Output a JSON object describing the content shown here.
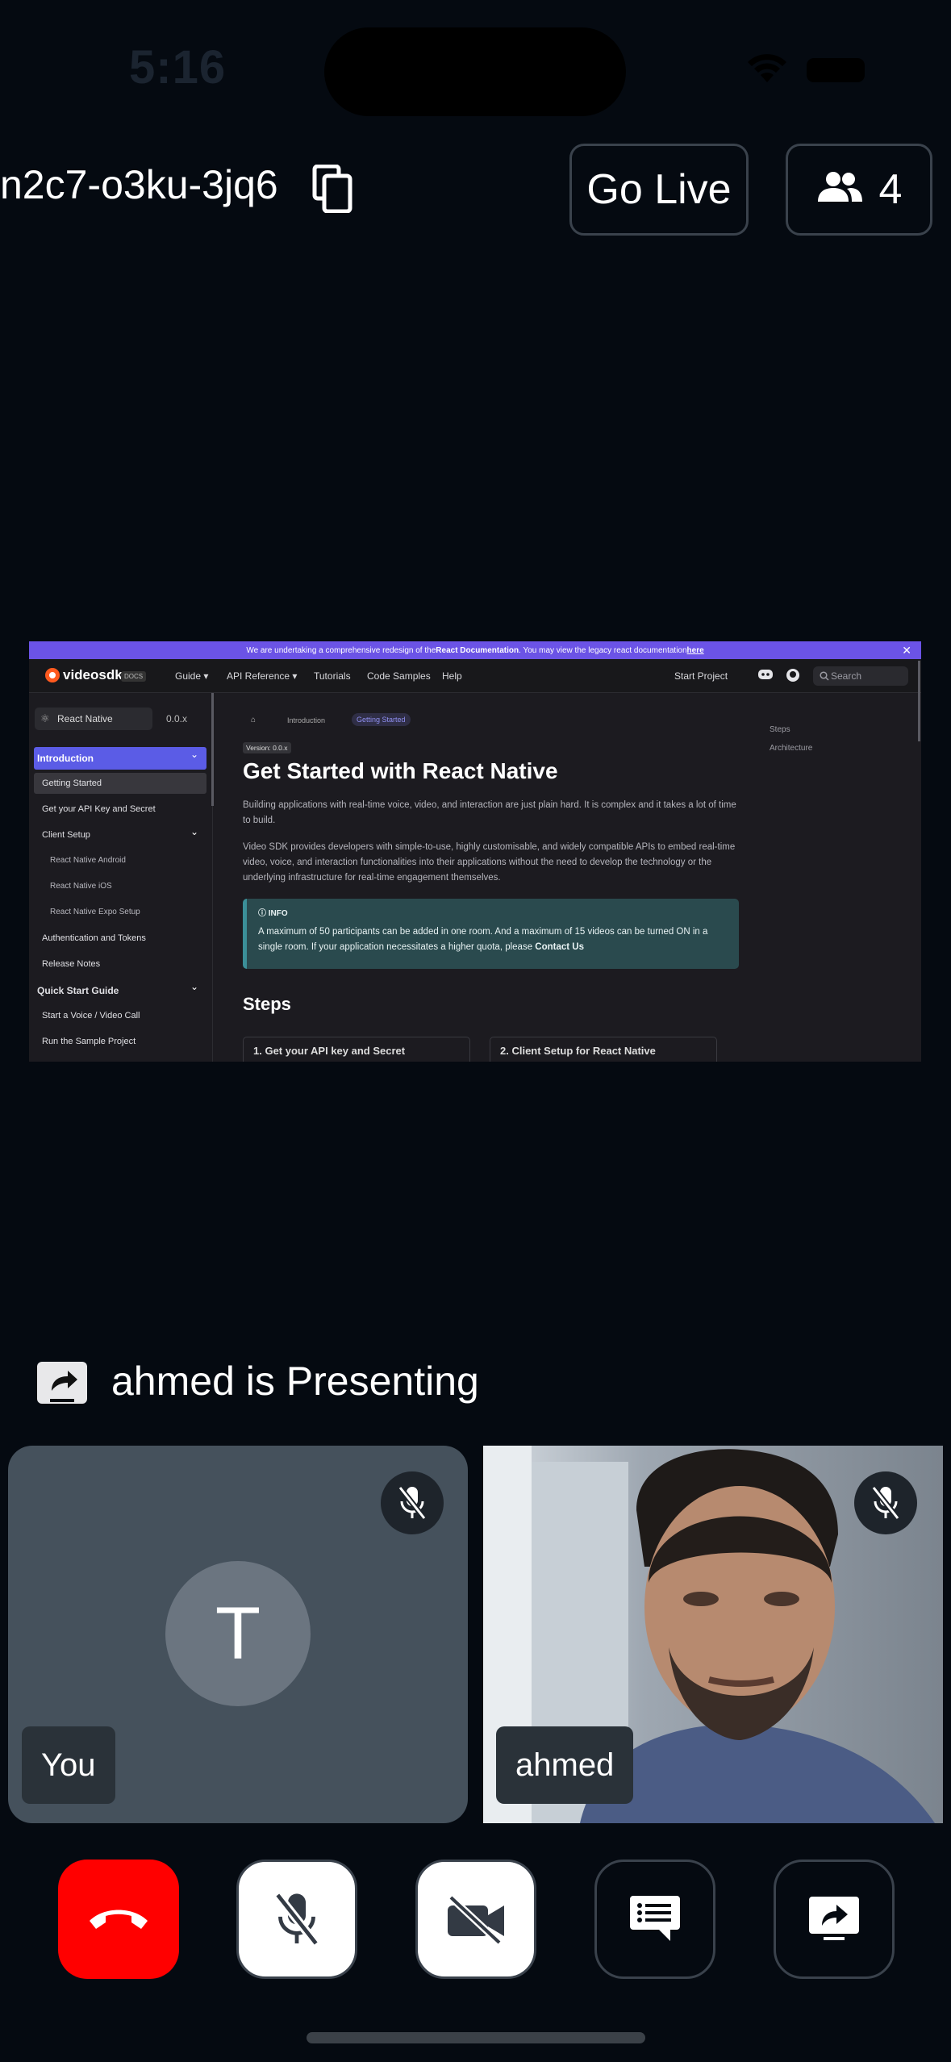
{
  "status_bar": {
    "time": "5:16"
  },
  "header": {
    "meeting_id": "n2c7-o3ku-3jq6",
    "go_live_label": "Go Live",
    "participant_count": "4"
  },
  "shared_screen": {
    "banner_prefix": "We are undertaking a comprehensive redesign of the ",
    "banner_bold": "React Documentation",
    "banner_mid": ". You may view the legacy react documentation ",
    "banner_link": "here",
    "logo": "videosdk",
    "logo_badge": "DOCS",
    "nav": [
      "Guide ▾",
      "API Reference ▾",
      "Tutorials",
      "Code Samples",
      "Help"
    ],
    "nav_right": "Start Project",
    "search_placeholder": "Search",
    "platform_select": "React Native",
    "version_select": "0.0.x",
    "sidebar": [
      {
        "label": "Introduction",
        "kind": "active",
        "chevron": "⌄"
      },
      {
        "label": "Getting Started",
        "kind": "current"
      },
      {
        "label": "Get your API Key and Secret",
        "kind": "normal"
      },
      {
        "label": "Client Setup",
        "kind": "normal",
        "chevron": "⌄"
      },
      {
        "label": "React Native Android",
        "kind": "sub"
      },
      {
        "label": "React Native iOS",
        "kind": "sub"
      },
      {
        "label": "React Native Expo Setup",
        "kind": "sub"
      },
      {
        "label": "Authentication and Tokens",
        "kind": "normal"
      },
      {
        "label": "Release Notes",
        "kind": "normal"
      },
      {
        "label": "Quick Start Guide",
        "kind": "section",
        "chevron": "⌄"
      },
      {
        "label": "Start a Voice / Video Call",
        "kind": "normal"
      },
      {
        "label": "Run the Sample Project",
        "kind": "normal"
      }
    ],
    "breadcrumb": [
      "Introduction",
      "Getting Started"
    ],
    "version_tag": "Version: 0.0.x",
    "title": "Get Started with React Native",
    "paragraph_1": "Building applications with real-time voice, video, and interaction are just plain hard. It is complex and it takes a lot of time to build.",
    "paragraph_2": "Video SDK provides developers with simple-to-use, highly customisable, and widely compatible APIs to embed real-time video, voice, and interaction functionalities into their applications without the need to develop the technology or the underlying infrastructure for real-time engagement themselves.",
    "info_label": "INFO",
    "info_text": "A maximum of 50 participants can be added in one room. And a maximum of 15 videos can be turned ON in a single room. If your application necessitates a higher quota, please ",
    "info_link": "Contact Us",
    "steps_heading": "Steps",
    "step_cards": [
      "1. Get your API key and Secret",
      "2. Client Setup for React Native"
    ],
    "toc": [
      "Steps",
      "Architecture"
    ]
  },
  "presenting_text": "ahmed is Presenting",
  "tiles": {
    "you": {
      "name": "You",
      "initial": "T"
    },
    "ahmed": {
      "name": "ahmed"
    }
  },
  "colors": {
    "end_call": "#ff0000",
    "background": "#050a11",
    "tile": "#45515c"
  }
}
